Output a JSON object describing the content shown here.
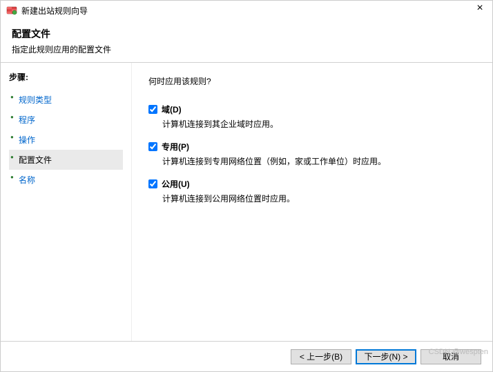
{
  "window": {
    "title": "新建出站规则向导"
  },
  "header": {
    "title": "配置文件",
    "subtitle": "指定此规则应用的配置文件"
  },
  "sidebar": {
    "steps_label": "步骤:",
    "items": [
      {
        "label": "规则类型"
      },
      {
        "label": "程序"
      },
      {
        "label": "操作"
      },
      {
        "label": "配置文件"
      },
      {
        "label": "名称"
      }
    ],
    "active_index": 3
  },
  "content": {
    "question": "何时应用该规则?",
    "checkboxes": [
      {
        "label": "域(D)",
        "checked": true,
        "desc": "计算机连接到其企业域时应用。"
      },
      {
        "label": "专用(P)",
        "checked": true,
        "desc": "计算机连接到专用网络位置（例如，家或工作单位）时应用。"
      },
      {
        "label": "公用(U)",
        "checked": true,
        "desc": "计算机连接到公用网络位置时应用。"
      }
    ]
  },
  "footer": {
    "back": "< 上一步(B)",
    "next": "下一步(N) >",
    "cancel": "取消"
  },
  "watermark": "CSDN @wespten"
}
